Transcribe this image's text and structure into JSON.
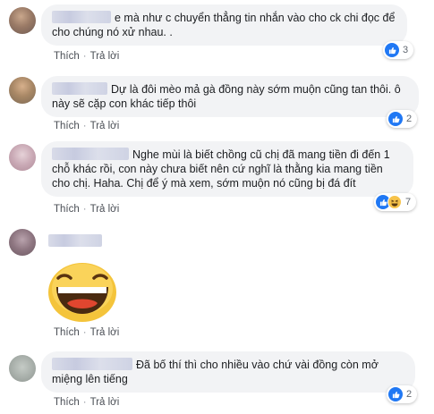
{
  "actions": {
    "like": "Thích",
    "reply": "Trả lời",
    "separator": "·"
  },
  "comments": [
    {
      "text": "e mà như c chuyển thẳng tin nhắn vào cho ck chi đọc để cho chúng nó xử nhau. .",
      "reactions": {
        "count": "3",
        "types": [
          "like"
        ]
      }
    },
    {
      "text": "Dự là đôi mèo mả gà đồng này sớm muộn cũng tan thôi. ô này sẽ cặp con khác tiếp thôi",
      "reactions": {
        "count": "2",
        "types": [
          "like"
        ]
      }
    },
    {
      "text": "Nghe mùi là biết chồng cũ chị đã mang tiền đi đến 1 chỗ khác rồi, con này chưa biết nên cứ nghĩ là thằng kia mang tiền cho chị. Haha. Chị để ý mà xem, sớm muộn nó cũng bị đá đít",
      "reactions": {
        "count": "7",
        "types": [
          "like",
          "haha"
        ]
      }
    },
    {
      "text": "",
      "sticker": "laughing-face-sticker"
    },
    {
      "text": "Đã bố thí thì cho nhiều vào chứ vài đồng còn mở miệng lên tiếng",
      "reactions": {
        "count": "2",
        "types": [
          "like"
        ]
      }
    }
  ],
  "colors": {
    "like_blue": "#2078f4",
    "haha_yellow": "#f7c34a",
    "bubble_gray": "#f2f3f5"
  }
}
